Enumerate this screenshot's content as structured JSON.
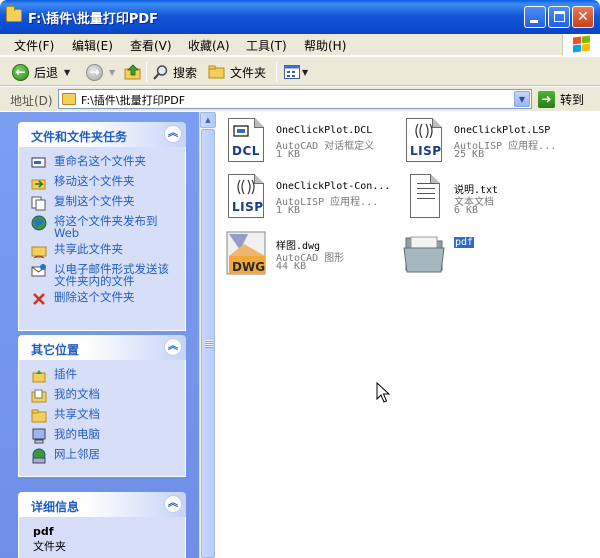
{
  "window": {
    "title": "F:\\插件\\批量打印PDF"
  },
  "menu": [
    "文件(F)",
    "编辑(E)",
    "查看(V)",
    "收藏(A)",
    "工具(T)",
    "帮助(H)"
  ],
  "toolbar": {
    "back": "后退",
    "search": "搜索",
    "folders": "文件夹"
  },
  "address": {
    "label": "地址(D)",
    "value": "F:\\插件\\批量打印PDF",
    "go": "转到"
  },
  "tasks_panel": {
    "title": "文件和文件夹任务",
    "items": [
      "重命名这个文件夹",
      "移动这个文件夹",
      "复制这个文件夹",
      "将这个文件夹发布到 Web",
      "共享此文件夹",
      "以电子邮件形式发送该文件夹内的文件",
      "删除这个文件夹"
    ]
  },
  "places_panel": {
    "title": "其它位置",
    "items": [
      "插件",
      "我的文档",
      "共享文档",
      "我的电脑",
      "网上邻居"
    ]
  },
  "details_panel": {
    "title": "详细信息",
    "name": "pdf",
    "type": "文件夹"
  },
  "files": [
    {
      "name": "OneClickPlot.DCL",
      "type": "AutoCAD 对话框定义",
      "size": "1 KB",
      "icon": "dcl-file-icon"
    },
    {
      "name": "OneClickPlot.LSP",
      "type": "AutoLISP 应用程...",
      "size": "25 KB",
      "icon": "lisp-file-icon"
    },
    {
      "name": "OneClickPlot-Con...",
      "type": "AutoLISP 应用程...",
      "size": "1 KB",
      "icon": "lisp-file-icon"
    },
    {
      "name": "说明.txt",
      "type": "文本文档",
      "size": "6 KB",
      "icon": "text-file-icon"
    },
    {
      "name": "样图.dwg",
      "type": "AutoCAD 图形",
      "size": "44 KB",
      "icon": "dwg-file-icon"
    },
    {
      "name": "pdf",
      "type": "",
      "size": "",
      "icon": "folder-icon"
    }
  ],
  "colors": {
    "titlebar": "#0a4bd0",
    "leftpane": "#7b9ef0",
    "panel_text": "#215dc6",
    "selection": "#316ac5"
  }
}
